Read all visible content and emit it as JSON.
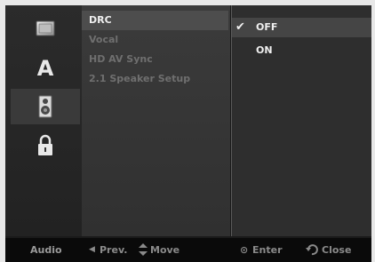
{
  "categories": [
    {
      "name": "disc-icon",
      "selected": false
    },
    {
      "name": "language-icon",
      "glyph": "A",
      "selected": false
    },
    {
      "name": "speaker-icon",
      "selected": true
    },
    {
      "name": "lock-icon",
      "selected": false
    }
  ],
  "menu": {
    "items": [
      {
        "label": "DRC",
        "selected": true
      },
      {
        "label": "Vocal",
        "selected": false
      },
      {
        "label": "HD AV Sync",
        "selected": false
      },
      {
        "label": "2.1 Speaker Setup",
        "selected": false
      }
    ]
  },
  "options": {
    "check_glyph": "✔",
    "items": [
      {
        "label": "OFF",
        "selected": true
      },
      {
        "label": "ON",
        "selected": false
      }
    ]
  },
  "bottom_bar": {
    "section": "Audio",
    "prev_icon": "◀",
    "prev": "Prev.",
    "move_icon": "up-down-arrows-icon",
    "move": "Move",
    "enter_icon": "⊙",
    "enter": "Enter",
    "close_icon": "return-icon",
    "close": "Close"
  },
  "colors": {
    "selected_item": "#4d4d4d",
    "text": "#f0f0f0",
    "dim_text": "#6f6f6f"
  }
}
